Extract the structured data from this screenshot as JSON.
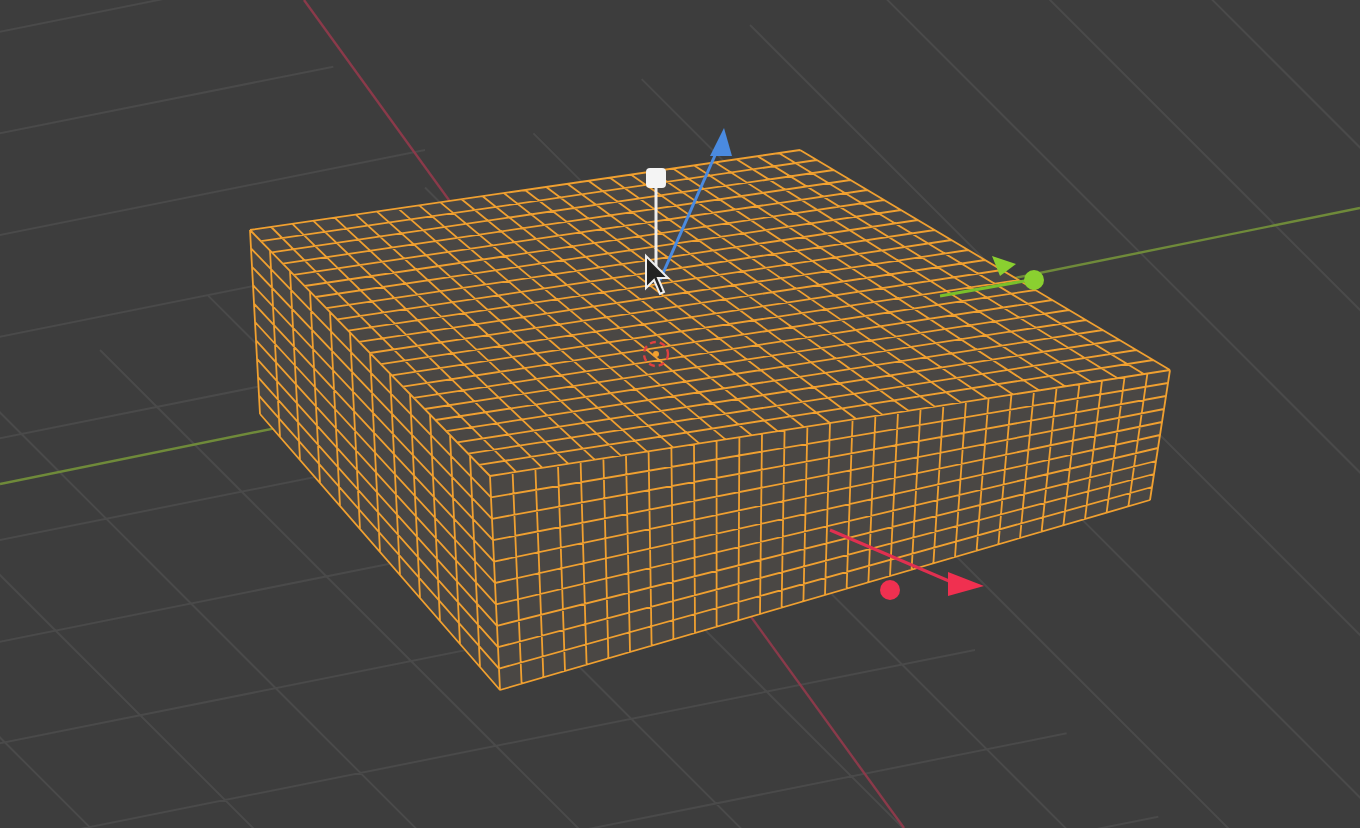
{
  "viewport": {
    "mesh": {
      "selected": true
    }
  }
}
